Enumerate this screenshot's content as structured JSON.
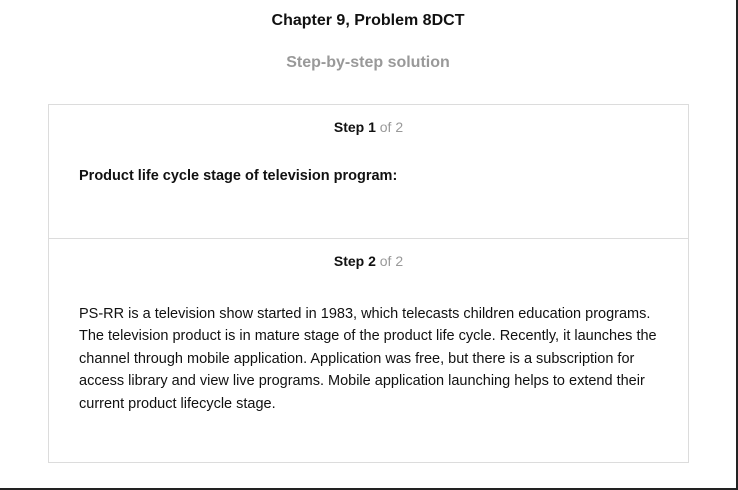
{
  "header": {
    "chapter_title": "Chapter 9, Problem 8DCT",
    "solution_heading": "Step-by-step solution"
  },
  "steps": [
    {
      "label": "Step 1",
      "of_text": "of 2",
      "body": "Product life cycle stage of television program:"
    },
    {
      "label": "Step 2",
      "of_text": "of 2",
      "body": "PS-RR is a television show started in 1983, which telecasts children education programs. The television product is in mature stage of the product life cycle. Recently, it launches the channel through mobile application. Application was free, but there is a subscription for access library and view live programs. Mobile application launching helps to extend their current product lifecycle stage."
    }
  ],
  "colors": {
    "text": "#111111",
    "muted": "#999999",
    "border": "#dcdcdc"
  }
}
